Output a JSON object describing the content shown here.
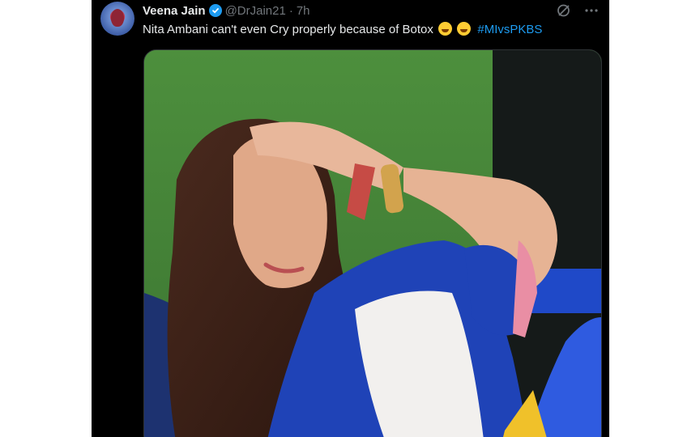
{
  "author": {
    "display_name": "Veena Jain",
    "handle": "@DrJain21",
    "separator": "·",
    "timestamp": "7h",
    "verified": true
  },
  "tweet": {
    "text": "Nita Ambani can't even Cry properly because of Botox",
    "emojis": [
      "laughing-face",
      "crying-face"
    ],
    "hashtag": "#MIvsPKBS"
  },
  "icons": [
    "grok-icon",
    "more-options-icon"
  ],
  "colors": {
    "background": "#000000",
    "text": "#e7e9ea",
    "secondary": "#71767b",
    "link": "#1d9bf0"
  }
}
